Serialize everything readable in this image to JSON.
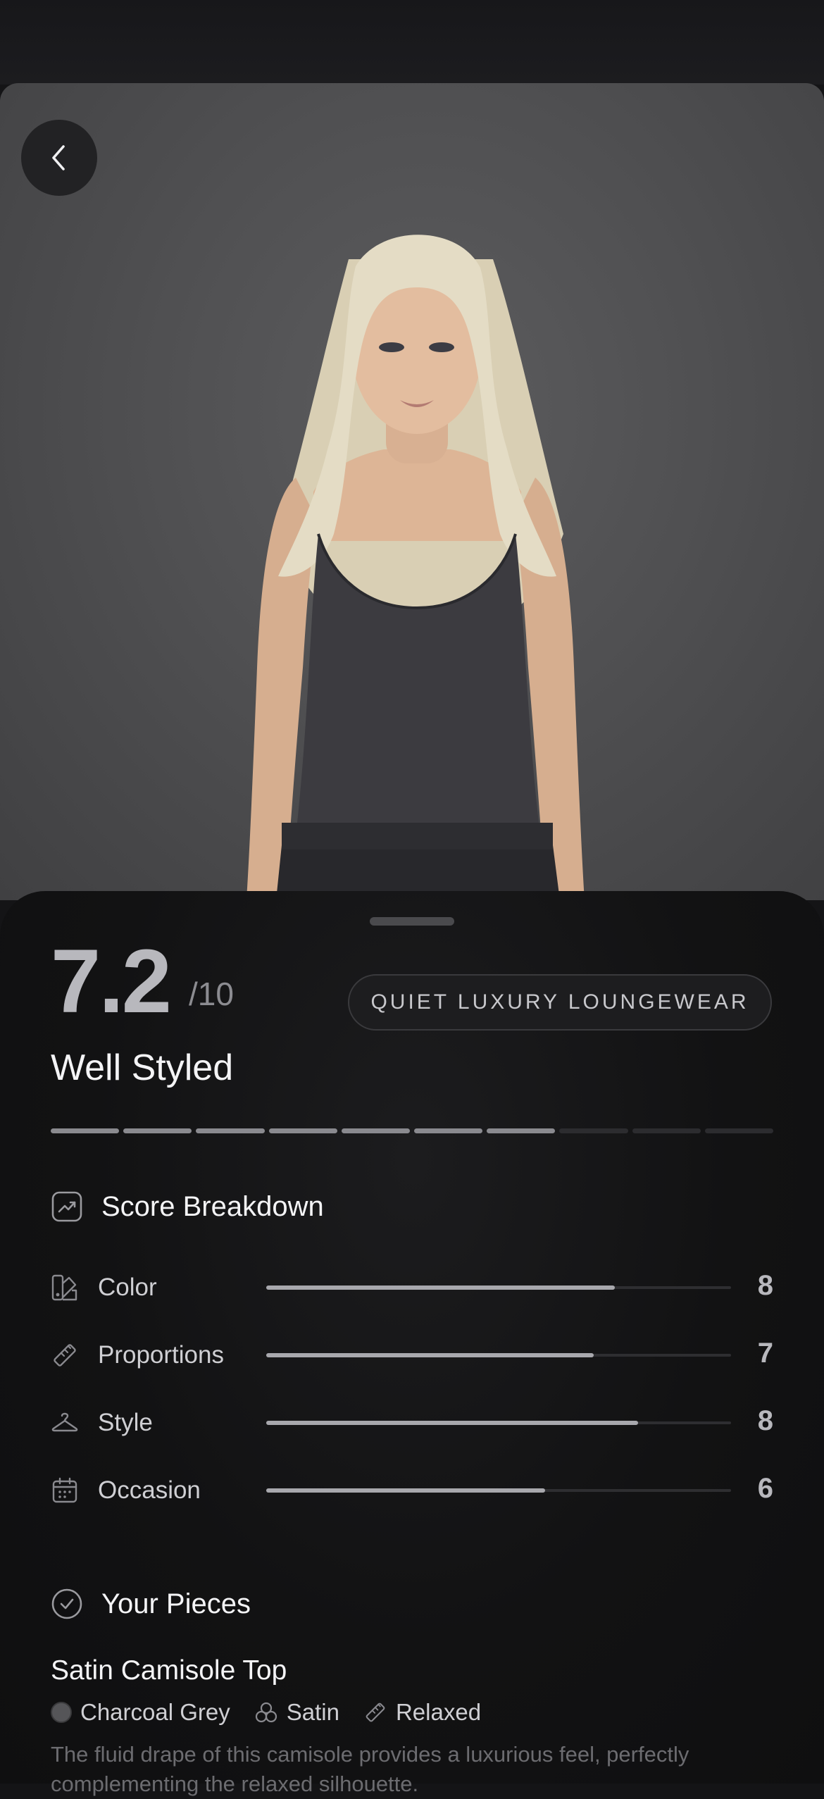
{
  "photo": {
    "back_icon": "chevron-left-icon",
    "background_color": "#505052"
  },
  "score": {
    "value": "7.2",
    "max": "/10",
    "label": "Well Styled",
    "segments_total": 10,
    "segments_filled": 7
  },
  "style_tag": "QUIET LUXURY LOUNGEWEAR",
  "breakdown": {
    "title": "Score Breakdown",
    "icon": "trend-chart-icon",
    "items": [
      {
        "label": "Color",
        "value": "8",
        "fraction": 0.75,
        "icon": "palette-icon"
      },
      {
        "label": "Proportions",
        "value": "7",
        "fraction": 0.705,
        "icon": "ruler-icon"
      },
      {
        "label": "Style",
        "value": "8",
        "fraction": 0.8,
        "icon": "hanger-icon"
      },
      {
        "label": "Occasion",
        "value": "6",
        "fraction": 0.6,
        "icon": "calendar-icon"
      }
    ]
  },
  "pieces": {
    "title": "Your Pieces",
    "icon": "check-circle-icon",
    "items": [
      {
        "name": "Satin Camisole Top",
        "color": "Charcoal Grey",
        "color_hex": "#555558",
        "fabric": "Satin",
        "fit": "Relaxed",
        "description": "The fluid drape of this camisole provides a luxurious feel, perfectly complementing the relaxed silhouette."
      }
    ]
  },
  "colors": {
    "accent_fill": "#a8a8ad",
    "track": "#2e2e31",
    "sheet": "#121213"
  }
}
